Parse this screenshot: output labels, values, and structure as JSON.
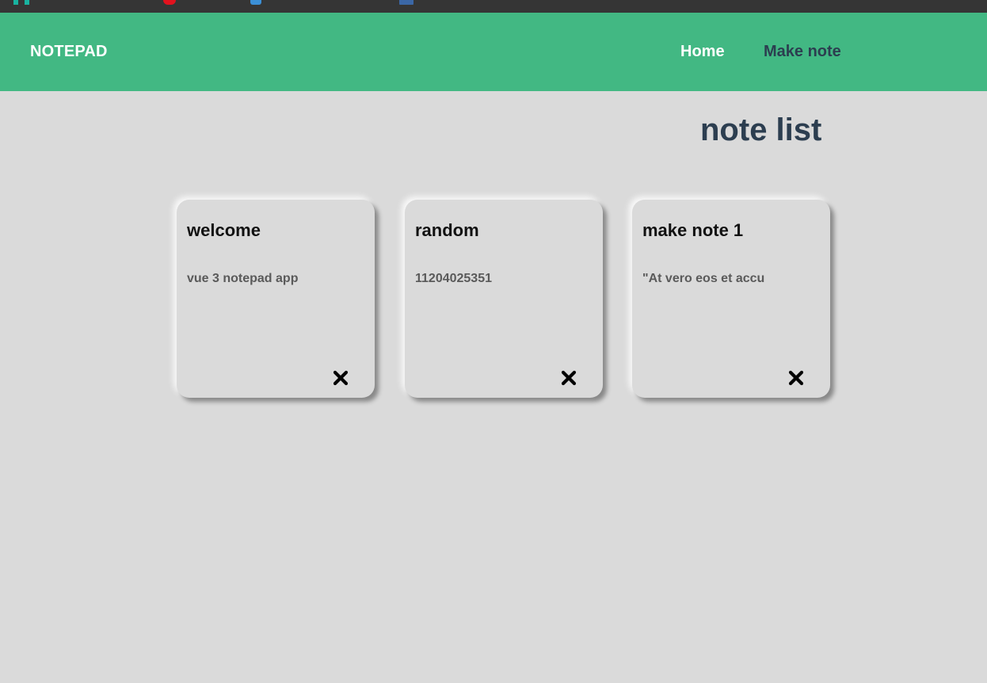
{
  "header": {
    "brand": "NOTEPAD",
    "nav": [
      {
        "label": "Home",
        "active": true
      },
      {
        "label": "Make note",
        "active": false
      }
    ]
  },
  "main": {
    "title": "note list",
    "notes": [
      {
        "title": "welcome",
        "body": "vue 3 notepad app",
        "delete_icon": "close-icon"
      },
      {
        "title": "random",
        "body": "11204025351",
        "delete_icon": "close-icon"
      },
      {
        "title": "make note 1",
        "body": "\"At vero eos et accu",
        "delete_icon": "close-icon"
      }
    ]
  },
  "colors": {
    "navbar": "#42b883",
    "background": "#dadada",
    "title_text": "#2c3e50",
    "bookmarks_bar": "#353535"
  }
}
